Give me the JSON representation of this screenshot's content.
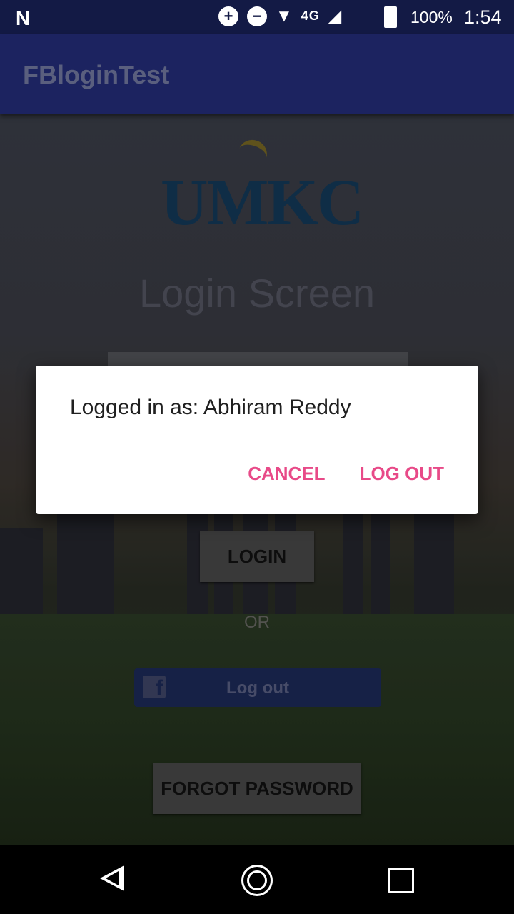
{
  "status_bar": {
    "notification_icon": "n-icon",
    "battery_percent": "100%",
    "time": "1:54",
    "network": "4G"
  },
  "app_bar": {
    "title": "FBloginTest"
  },
  "screen": {
    "logo_text": "UMKC",
    "title": "Login Screen",
    "login_button": "LOGIN",
    "or_text": "OR",
    "fb_button": "Log out",
    "forgot_button": "FORGOT PASSWORD"
  },
  "dialog": {
    "message": "Logged in as: Abhiram Reddy",
    "cancel_label": "CANCEL",
    "logout_label": "LOG OUT",
    "accent_color": "#e84a88"
  },
  "nav_bar": {
    "back": "back-icon",
    "home": "home-icon",
    "recents": "recents-icon"
  }
}
